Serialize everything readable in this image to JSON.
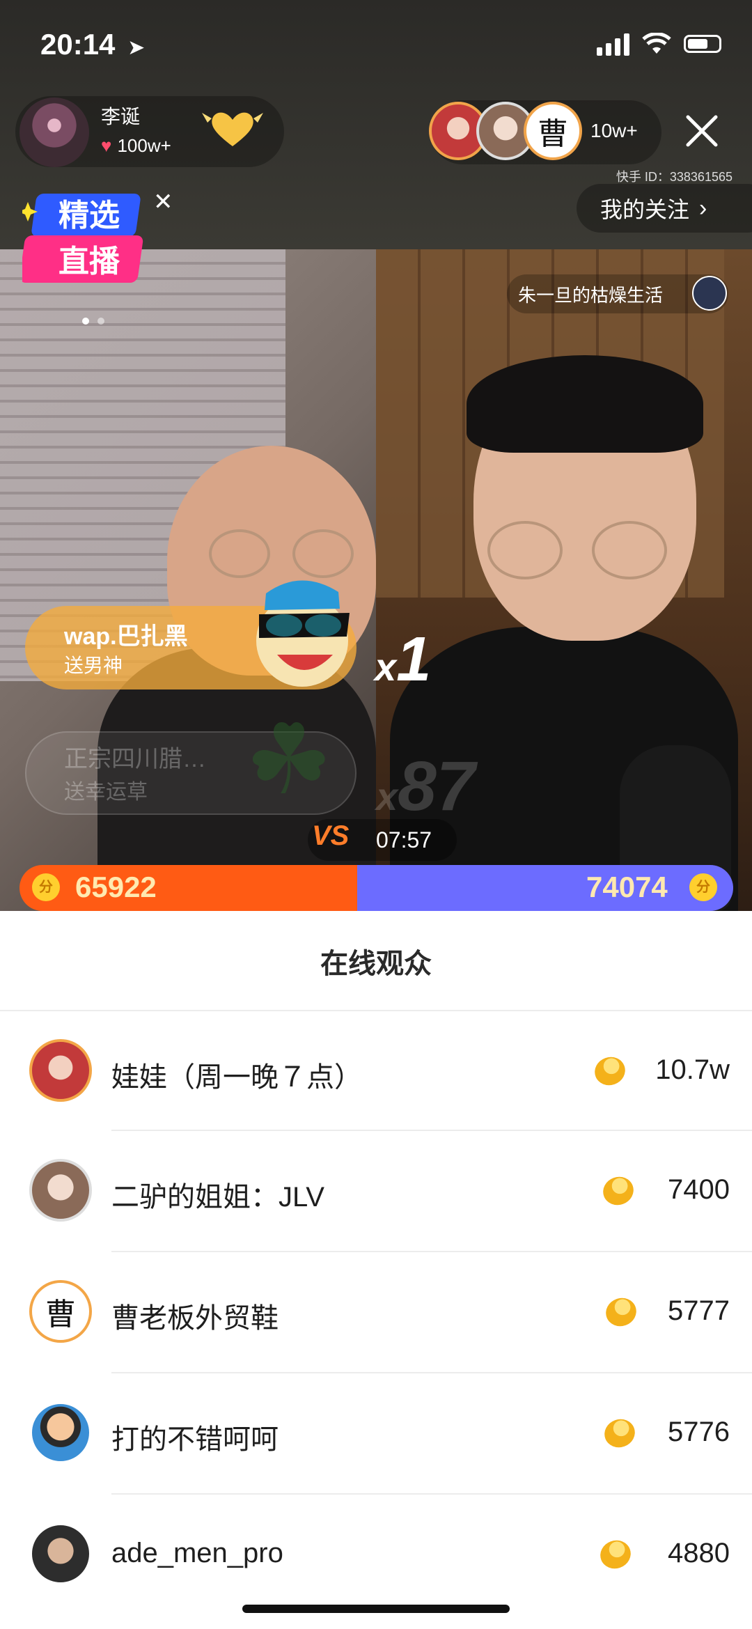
{
  "status_bar": {
    "time": "20:14",
    "location_arrow": "location-arrow-icon"
  },
  "host": {
    "name": "李诞",
    "likes": "100w+"
  },
  "viewers": {
    "count": "10w+"
  },
  "kuaishou_id": "快手 ID：338361565",
  "follow_label": "我的关注",
  "badge": {
    "line1": "精选",
    "line2": "直播"
  },
  "peer": {
    "name": "朱一旦的枯燥生活"
  },
  "gift_main": {
    "sender": "wap.巴扎黑",
    "text": "送男神",
    "count": "1"
  },
  "gift_faded": {
    "sender": "正宗四川腊…",
    "text": "送幸运草",
    "count": "87"
  },
  "pk": {
    "vs": "VS",
    "timer": "07:57",
    "left_score": "65922",
    "right_score": "74074",
    "coin_label": "分"
  },
  "panel": {
    "title": "在线观众",
    "rows": [
      {
        "name": "娃娃（周一晚７点）",
        "value": "10.7w"
      },
      {
        "name": "二驴的姐姐：JLV",
        "value": "7400"
      },
      {
        "name": "曹老板外贸鞋",
        "value": "5777"
      },
      {
        "name": "打的不错呵呵",
        "value": "5776"
      },
      {
        "name": "ade_men_pro",
        "value": "4880"
      }
    ]
  },
  "colors": {
    "left_team": "#ff5b14",
    "right_team": "#6c6cff",
    "accent": "#f3a647"
  }
}
